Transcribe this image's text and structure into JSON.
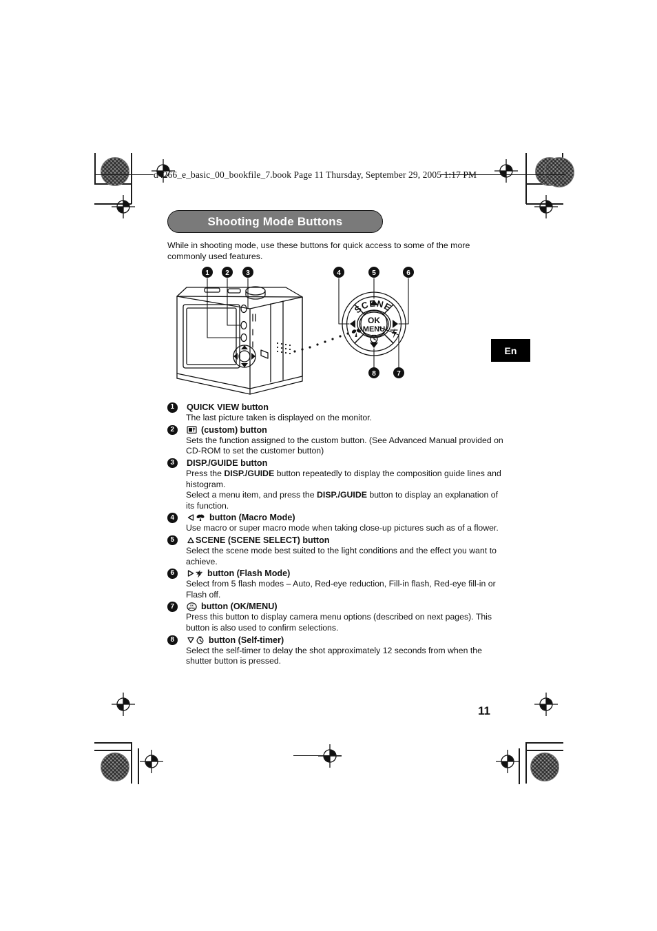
{
  "print": {
    "header_slug": "d4266_e_basic_00_bookfile_7.book  Page 11  Thursday, September 29, 2005  1:17 PM"
  },
  "page": {
    "title": "Shooting Mode Buttons",
    "intro": "While in shooting mode, use these buttons for quick access to some of the more commonly used features.",
    "language_tab": "En",
    "folio": "11"
  },
  "figure": {
    "callout_numbers": [
      "1",
      "2",
      "3",
      "4",
      "5",
      "6",
      "7",
      "8"
    ],
    "control_pad": {
      "scene_label": "SCENE",
      "ok_label": "OK",
      "menu_label": "MENU"
    }
  },
  "items": [
    {
      "num": "1",
      "icons": [],
      "heading": "QUICK VIEW button",
      "body": [
        {
          "text": "The last picture taken is displayed on the monitor."
        }
      ]
    },
    {
      "num": "2",
      "icons": [
        "custom-button-icon"
      ],
      "heading": "(custom) button",
      "body": [
        {
          "text": "Sets the function assigned to the custom button. (See Advanced Manual provided on CD-ROM to set the customer button)"
        }
      ]
    },
    {
      "num": "3",
      "icons": [],
      "heading": "DISP./GUIDE button",
      "body": [
        {
          "pre": "Press the ",
          "bold": "DISP./GUIDE",
          "post": " button repeatedly to display the composition guide lines and histogram."
        },
        {
          "pre": "Select a menu item, and press the ",
          "bold": "DISP./GUIDE",
          "post": " button to display an explanation of its function."
        }
      ]
    },
    {
      "num": "4",
      "icons": [
        "triangle-left-icon",
        "macro-flower-icon"
      ],
      "heading": "button (Macro Mode)",
      "body": [
        {
          "text": "Use macro or super macro mode when taking close-up pictures such as of a flower."
        }
      ]
    },
    {
      "num": "5",
      "icons": [
        "triangle-up-icon"
      ],
      "heading": "SCENE (SCENE SELECT) button",
      "body": [
        {
          "text": "Select the scene mode best suited to the light conditions and the effect you want to achieve."
        }
      ]
    },
    {
      "num": "6",
      "icons": [
        "triangle-right-icon",
        "flash-bolt-icon"
      ],
      "heading": "button (Flash Mode)",
      "body": [
        {
          "text": "Select from 5 flash modes – Auto, Red-eye reduction, Fill-in flash, Red-eye fill-in or Flash off."
        }
      ]
    },
    {
      "num": "7",
      "icons": [
        "ok-menu-button-icon"
      ],
      "heading": "button (OK/MENU)",
      "body": [
        {
          "text": "Press this button to display camera menu options (described on next pages). This button is also used to confirm selections."
        }
      ]
    },
    {
      "num": "8",
      "icons": [
        "triangle-down-icon",
        "self-timer-icon"
      ],
      "heading": "button (Self-timer)",
      "body": [
        {
          "text": "Select the self-timer to delay the shot approximately 12 seconds from when the shutter button is pressed."
        }
      ]
    }
  ]
}
